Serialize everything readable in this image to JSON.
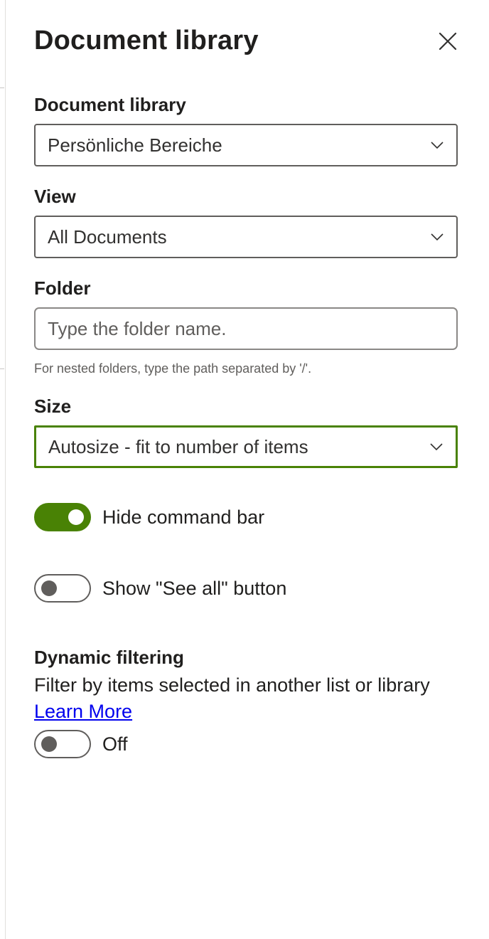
{
  "panel": {
    "title": "Document library"
  },
  "fields": {
    "library": {
      "label": "Document library",
      "value": "Persönliche Bereiche"
    },
    "view": {
      "label": "View",
      "value": "All Documents"
    },
    "folder": {
      "label": "Folder",
      "placeholder": "Type the folder name.",
      "helper": "For nested folders, type the path separated by '/'."
    },
    "size": {
      "label": "Size",
      "value": "Autosize - fit to number of items"
    }
  },
  "toggles": {
    "hide_command_bar": {
      "label": "Hide command bar",
      "state": "on"
    },
    "see_all": {
      "label": "Show \"See all\" button",
      "state": "off"
    }
  },
  "dynamic_filtering": {
    "heading": "Dynamic filtering",
    "description": "Filter by items selected in another list or library",
    "link": "Learn More",
    "toggle_label": "Off",
    "state": "off"
  },
  "colors": {
    "accent": "#498205",
    "border": "#605e5c",
    "text": "#201f1e",
    "link": "#0000ee"
  },
  "icons": {
    "close": "close-icon",
    "dropdown": "chevron-down-icon"
  }
}
